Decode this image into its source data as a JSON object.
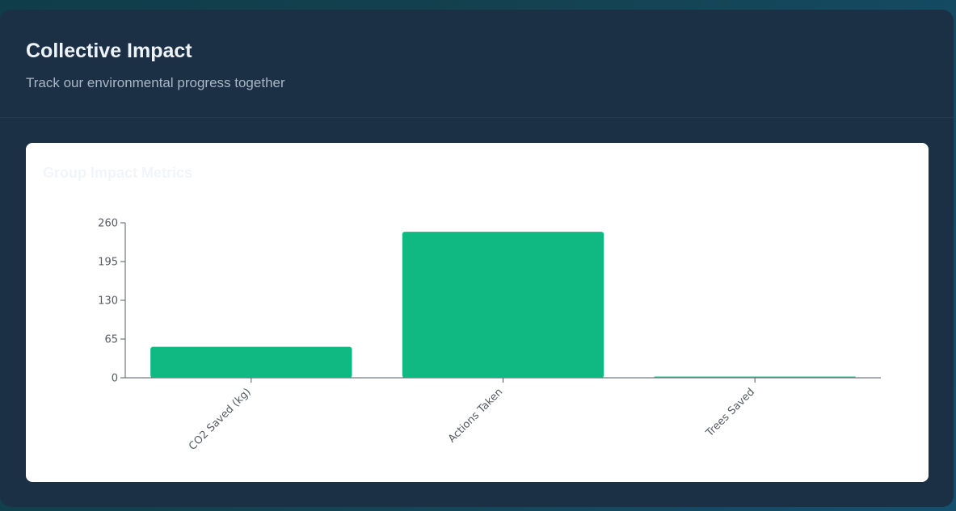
{
  "header": {
    "title": "Collective Impact",
    "subtitle": "Track our environmental progress together"
  },
  "chart_panel": {
    "title": "Group Impact Metrics"
  },
  "colors": {
    "bar": "#10b981",
    "axis": "#555b63"
  },
  "chart_data": {
    "type": "bar",
    "title": "Group Impact Metrics",
    "categories": [
      "CO2 Saved (kg)",
      "Actions Taken",
      "Trees Saved"
    ],
    "values": [
      52,
      245,
      2
    ],
    "xlabel": "",
    "ylabel": "",
    "ylim": [
      0,
      260
    ],
    "yticks": [
      0,
      65,
      130,
      195,
      260
    ],
    "grid": false,
    "legend": "none"
  }
}
